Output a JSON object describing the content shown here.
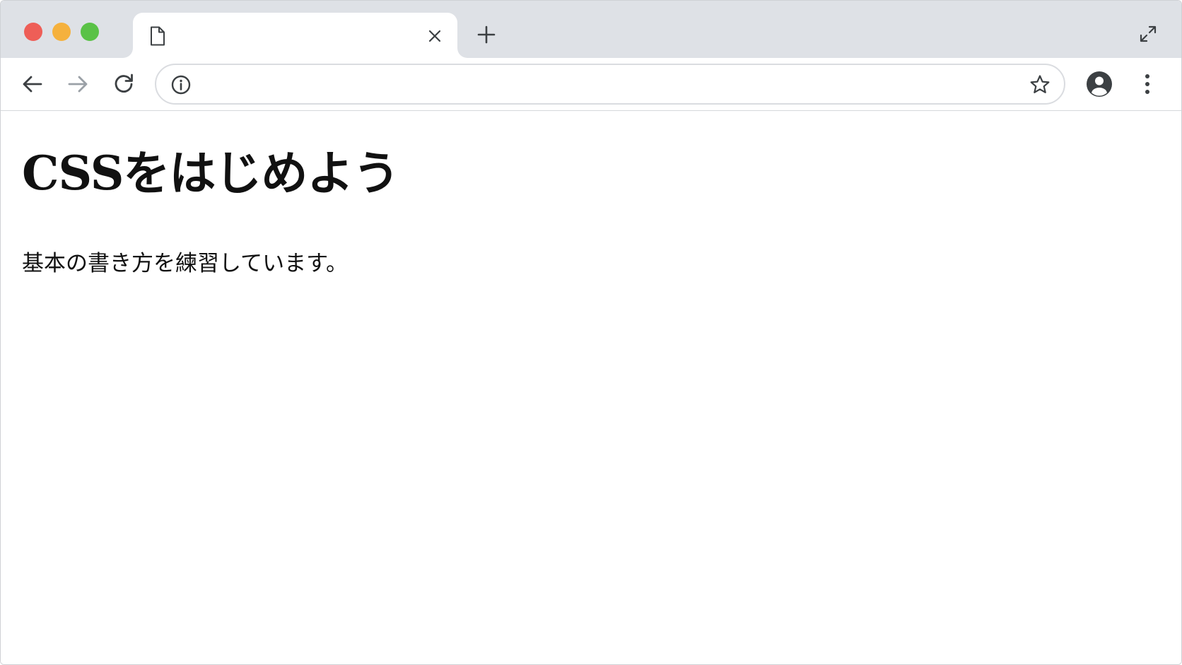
{
  "colors": {
    "traffic_close": "#ee5e57",
    "traffic_minimize": "#f5b13d",
    "traffic_maximize": "#5ac247",
    "tabstrip_bg": "#dee1e6",
    "icon": "#3c4043",
    "icon_disabled": "#9aa0a6",
    "text": "#111111"
  },
  "tab": {
    "title": "",
    "favicon": "document-icon"
  },
  "omnibox": {
    "value": "",
    "placeholder": ""
  },
  "icons": {
    "back": "arrow-left-icon",
    "forward": "arrow-right-icon",
    "reload": "reload-icon",
    "site_info": "info-icon",
    "bookmark": "star-icon",
    "profile": "account-circle-icon",
    "menu": "kebab-menu-icon",
    "new_tab": "plus-icon",
    "close_tab": "close-icon",
    "fullscreen": "expand-icon"
  },
  "page": {
    "heading": "CSSをはじめよう",
    "paragraph": "基本の書き方を練習しています。"
  }
}
